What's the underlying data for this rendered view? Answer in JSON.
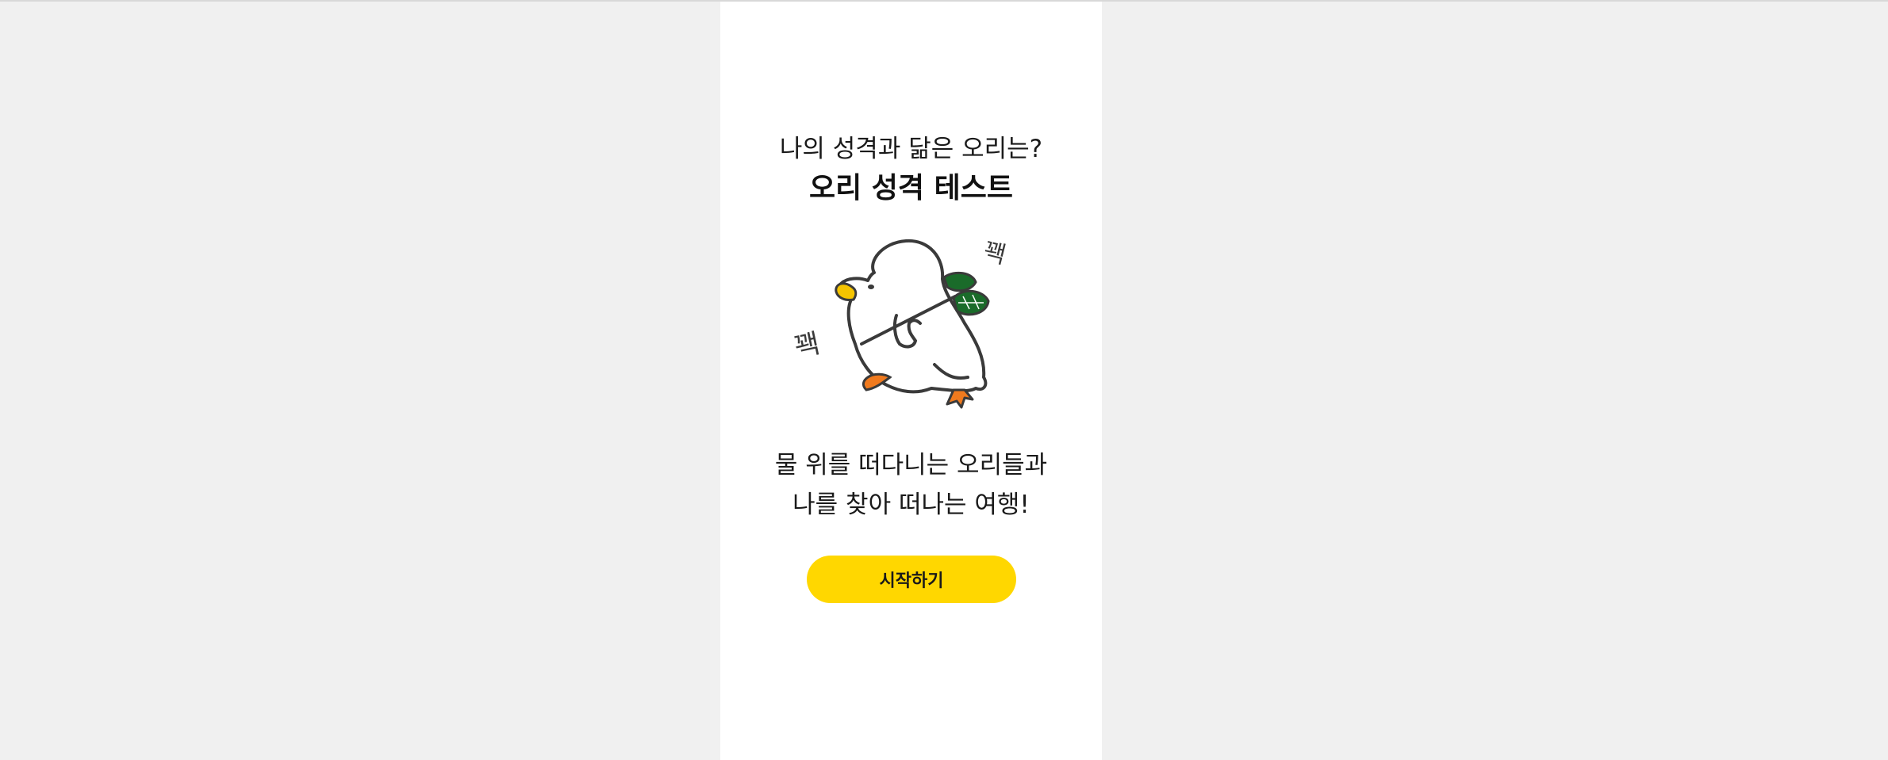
{
  "intro": {
    "subtitle": "나의 성격과 닮은 오리는?",
    "title": "오리 성격 테스트",
    "illustration_sound": "꽥",
    "description_line1": "물 위를 떠다니는 오리들과",
    "description_line2": "나를 찾아 떠나는 여행!",
    "start_button_label": "시작하기"
  },
  "colors": {
    "page_background": "#f0f0f0",
    "card_background": "#ffffff",
    "button_yellow": "#ffd700",
    "beak_yellow": "#f5c400",
    "feet_orange": "#f07a1e",
    "leaf_green": "#1a6b2a",
    "text_dark": "#1a1a1a"
  }
}
